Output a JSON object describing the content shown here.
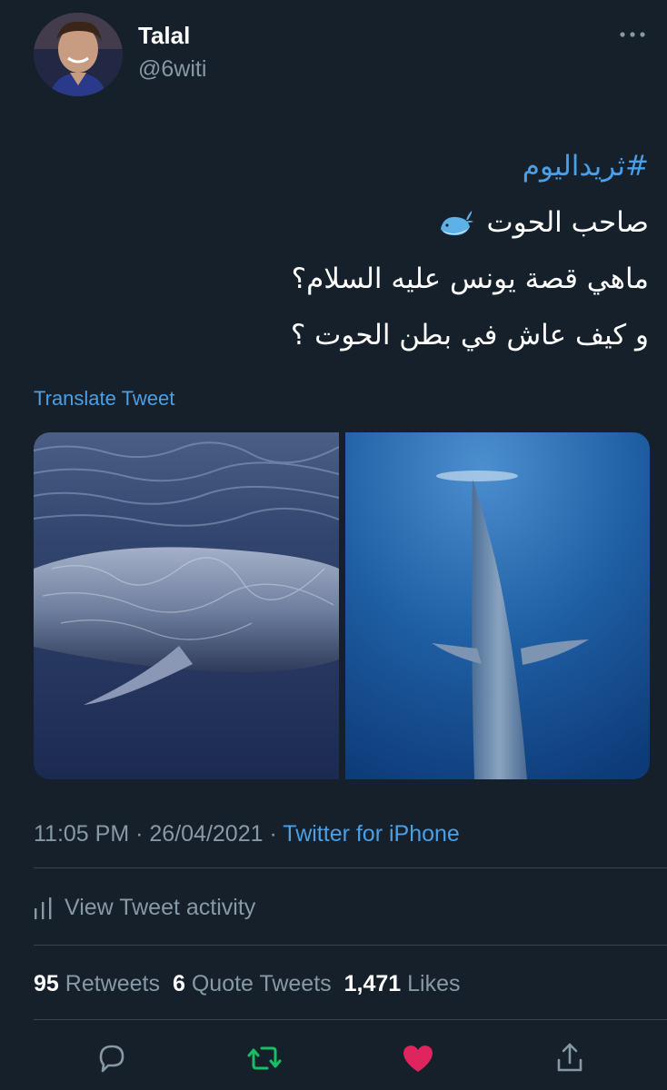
{
  "user": {
    "name": "Talal",
    "handle": "@6witi"
  },
  "tweet": {
    "hashtag": "#ثريداليوم",
    "line1": "صاحب الحوت",
    "line2": "ماهي قصة يونس عليه السلام؟",
    "line3": "و كيف عاش في بطن الحوت ؟",
    "emoji": "whale-emoji"
  },
  "translate_label": "Translate Tweet",
  "meta": {
    "time": "11:05 PM",
    "separator": "·",
    "date": "26/04/2021",
    "source": "Twitter for iPhone"
  },
  "activity_label": "View Tweet activity",
  "stats": {
    "retweets_count": "95",
    "retweets_label": "Retweets",
    "quotes_count": "6",
    "quotes_label": "Quote Tweets",
    "likes_count": "1,471",
    "likes_label": "Likes"
  },
  "icons": {
    "reply": "reply-icon",
    "retweet": "retweet-icon",
    "like": "heart-icon",
    "share": "share-icon",
    "more": "more-icon"
  },
  "colors": {
    "background": "#15202b",
    "link": "#4a9fe6",
    "secondary_text": "#8899a6",
    "retweet_active": "#17bf63",
    "like_active": "#e0245e"
  }
}
